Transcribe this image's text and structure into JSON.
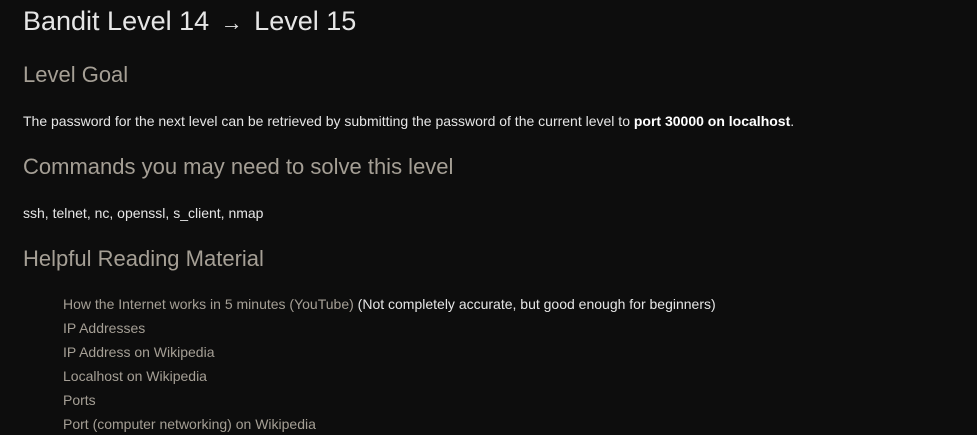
{
  "page": {
    "title_left": "Bandit Level 14",
    "title_arrow": "→",
    "title_right": "Level 15"
  },
  "goal": {
    "heading": "Level Goal",
    "text_prefix": "The password for the next level can be retrieved by submitting the password of the current level to ",
    "text_bold": "port 30000 on localhost",
    "text_suffix": "."
  },
  "commands": {
    "heading": "Commands you may need to solve this level",
    "list": "ssh, telnet, nc, openssl, s_client, nmap"
  },
  "reading": {
    "heading": "Helpful Reading Material",
    "items": [
      {
        "link": "How the Internet works in 5 minutes (YouTube)",
        "note": " (Not completely accurate, but good enough for beginners)"
      },
      {
        "link": "IP Addresses",
        "note": ""
      },
      {
        "link": "IP Address on Wikipedia",
        "note": ""
      },
      {
        "link": "Localhost on Wikipedia",
        "note": ""
      },
      {
        "link": "Ports",
        "note": ""
      },
      {
        "link": "Port (computer networking) on Wikipedia",
        "note": ""
      }
    ]
  },
  "colors": {
    "background": "#0d0d0d",
    "heading": "#a59f95",
    "text": "#e6e6e6",
    "link": "#a59f95"
  }
}
